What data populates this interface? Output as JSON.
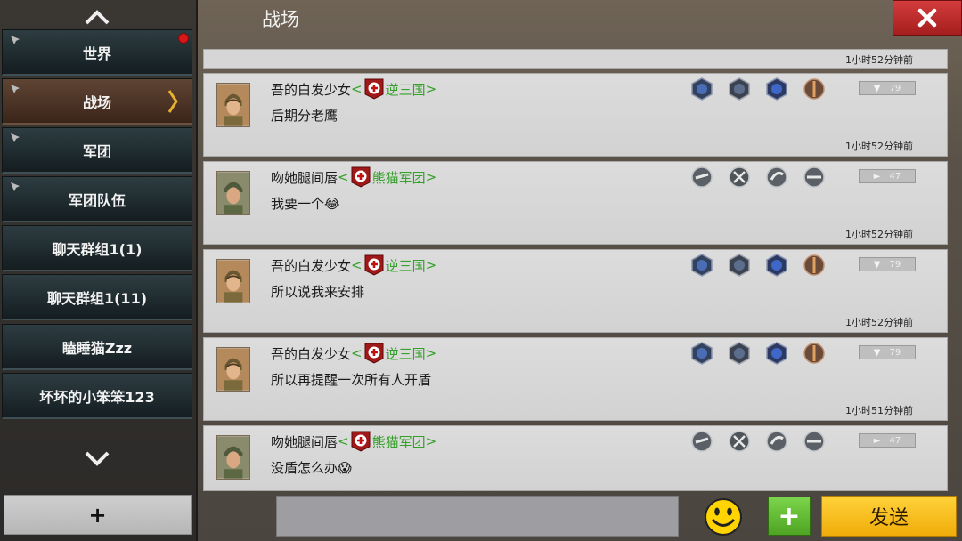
{
  "header": {
    "title": "战场"
  },
  "sidebar": {
    "items": [
      {
        "label": "世界",
        "pinned": true,
        "unread": true
      },
      {
        "label": "战场",
        "pinned": true,
        "active": true
      },
      {
        "label": "军团",
        "pinned": true
      },
      {
        "label": "军团队伍",
        "pinned": true
      },
      {
        "label": "聊天群组1(1)"
      },
      {
        "label": "聊天群组1(11)"
      },
      {
        "label": "瞌睡猫Zzz"
      },
      {
        "label": "坏坏的小笨笨123"
      }
    ],
    "add_label": "+"
  },
  "messages": [
    {
      "timestamp": "1小时52分钟前"
    },
    {
      "sender": "吾的白发少女",
      "guild_open": "<",
      "guild": "逆三国",
      "guild_close": ">",
      "text": "后期分老鹰",
      "level": "79",
      "timestamp": "1小时52分钟前",
      "avatar": "female-soldier",
      "badges": [
        "blue-rank-badge",
        "blue-rank-badge",
        "blue-rank-badge",
        "bronze-medal-badge"
      ]
    },
    {
      "sender": "吻她腿间唇",
      "guild_open": "<",
      "guild": "熊猫军团",
      "guild_close": ">",
      "text": "我要一个",
      "emoji": "😂",
      "level": "47",
      "timestamp": "1小时52分钟前",
      "avatar": "male-soldier",
      "badges": [
        "steel-badge",
        "crossed-swords-badge",
        "steel-badge",
        "steel-badge"
      ]
    },
    {
      "sender": "吾的白发少女",
      "guild_open": "<",
      "guild": "逆三国",
      "guild_close": ">",
      "text": "所以说我来安排",
      "level": "79",
      "timestamp": "1小时52分钟前",
      "avatar": "female-soldier",
      "badges": [
        "blue-rank-badge",
        "blue-rank-badge",
        "blue-rank-badge",
        "bronze-medal-badge"
      ]
    },
    {
      "sender": "吾的白发少女",
      "guild_open": "<",
      "guild": "逆三国",
      "guild_close": ">",
      "text": "所以再提醒一次所有人开盾",
      "level": "79",
      "timestamp": "1小时51分钟前",
      "avatar": "female-soldier",
      "badges": [
        "blue-rank-badge",
        "blue-rank-badge",
        "blue-rank-badge",
        "bronze-medal-badge"
      ]
    },
    {
      "sender": "吻她腿间唇",
      "guild_open": "<",
      "guild": "熊猫军团",
      "guild_close": ">",
      "text": "没盾怎么办",
      "emoji": "😱",
      "level": "47",
      "avatar": "male-soldier",
      "badges": [
        "steel-badge",
        "crossed-swords-badge",
        "steel-badge",
        "steel-badge"
      ]
    }
  ],
  "composer": {
    "input_value": "",
    "plus_label": "+",
    "send_label": "发送"
  },
  "colors": {
    "guild_green": "#35a02a",
    "send_yellow": "#f0ac0a",
    "close_red": "#c62b2b",
    "plus_green": "#5db62f"
  }
}
